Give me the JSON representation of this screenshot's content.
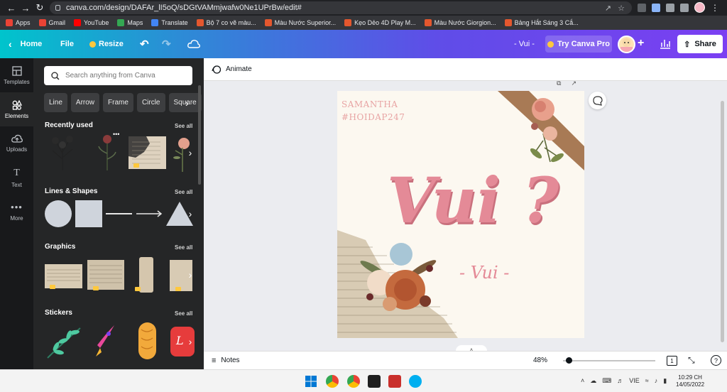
{
  "browser": {
    "url": "canva.com/design/DAFAr_lI5oQ/sDGtVAMmjwafw0Ne1UPrBw/edit#",
    "bookmarks": [
      {
        "label": "Apps",
        "color": "#ea4335"
      },
      {
        "label": "Gmail",
        "color": "#ea4335"
      },
      {
        "label": "YouTube",
        "color": "#ff0000"
      },
      {
        "label": "Maps",
        "color": "#34a853"
      },
      {
        "label": "Translate",
        "color": "#4285f4"
      },
      {
        "label": "Bộ 7 co vẽ màu...",
        "color": "#e4572e"
      },
      {
        "label": "Màu Nước Superior...",
        "color": "#e4572e"
      },
      {
        "label": "Kẹo Dẻo 4D Play M...",
        "color": "#e4572e"
      },
      {
        "label": "Màu Nước Giorgion...",
        "color": "#e4572e"
      },
      {
        "label": "Bảng Hắt Sáng 3 Cắ...",
        "color": "#e4572e"
      }
    ]
  },
  "topbar": {
    "home": "Home",
    "file": "File",
    "resize": "Resize",
    "doc_title": "- Vui -",
    "try_pro": "Try Canva Pro",
    "share": "Share"
  },
  "sidebar": {
    "items": [
      {
        "label": "Templates",
        "icon": "templates-icon"
      },
      {
        "label": "Elements",
        "icon": "elements-icon"
      },
      {
        "label": "Uploads",
        "icon": "cloud-upload-icon"
      },
      {
        "label": "Text",
        "icon": "text-icon"
      },
      {
        "label": "More",
        "icon": "more-icon"
      }
    ]
  },
  "panel": {
    "search_placeholder": "Search anything from Canva",
    "chips": [
      "Line",
      "Arrow",
      "Frame",
      "Circle",
      "Square"
    ],
    "sections": [
      {
        "title": "Recently used",
        "see_all": "See all"
      },
      {
        "title": "Lines & Shapes",
        "see_all": "See all"
      },
      {
        "title": "Graphics",
        "see_all": "See all"
      },
      {
        "title": "Stickers",
        "see_all": "See all"
      }
    ]
  },
  "editor": {
    "animate": "Animate",
    "notes": "Notes",
    "zoom": "48%",
    "page_count": "1",
    "help": "?"
  },
  "design": {
    "author_line1": "SAMANTHA",
    "author_line2": "#HOIDAP247",
    "headline": "Vui ?",
    "subline": "- Vui -"
  },
  "taskbar": {
    "lang": "VIE",
    "time": "10:29 CH",
    "date": "14/05/2022"
  },
  "colors": {
    "accent_gradient_start": "#00c4cc",
    "accent_gradient_end": "#7b3ff2",
    "headline_pink": "#e48a97",
    "author_pink": "#e8a4a4"
  }
}
